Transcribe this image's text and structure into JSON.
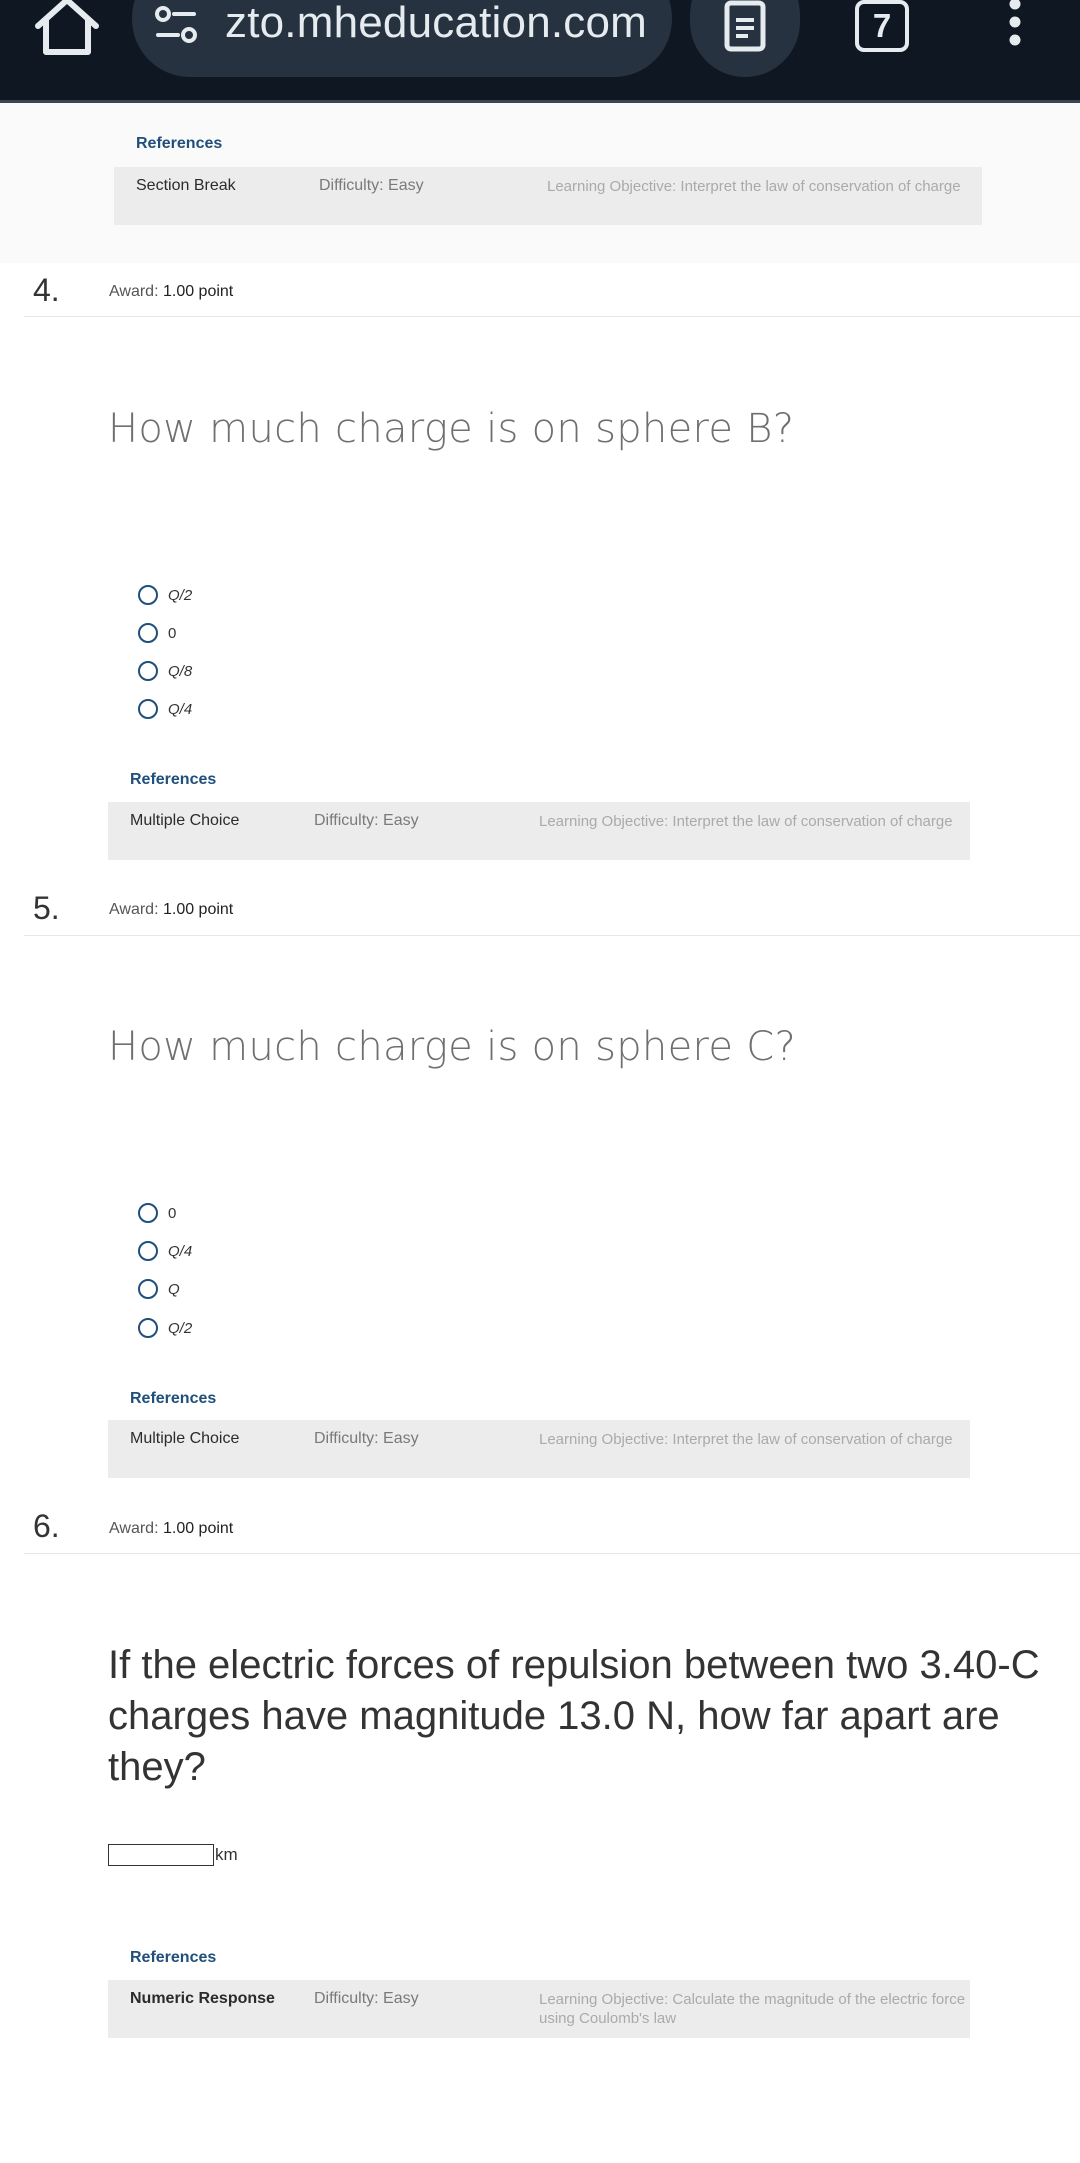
{
  "browser": {
    "url": "zto.mheducation.com",
    "tab_count": "7",
    "icons": [
      "home-icon",
      "site-settings-icon",
      "reader-mode-icon",
      "tabs-icon",
      "more-vert-icon"
    ]
  },
  "previous_block": {
    "references_label": "References",
    "type": "Section Break",
    "difficulty": "Difficulty: Easy",
    "objective": "Learning Objective: Interpret the law of conservation of charge"
  },
  "questions": [
    {
      "number": "4.",
      "award_label": "Award:",
      "award_value": "1.00 point",
      "prompt": "How much charge is on sphere B?",
      "options": [
        "Q/2",
        "0",
        "Q/8",
        "Q/4"
      ],
      "references_label": "References",
      "type": "Multiple Choice",
      "difficulty": "Difficulty: Easy",
      "objective": "Learning Objective: Interpret the law of conservation of charge"
    },
    {
      "number": "5.",
      "award_label": "Award:",
      "award_value": "1.00 point",
      "prompt": "How much charge is on sphere C?",
      "options": [
        "0",
        "Q/4",
        "Q",
        "Q/2"
      ],
      "references_label": "References",
      "type": "Multiple Choice",
      "difficulty": "Difficulty: Easy",
      "objective": "Learning Objective: Interpret the law of conservation of charge"
    },
    {
      "number": "6.",
      "award_label": "Award:",
      "award_value": "1.00 point",
      "prompt": "If the electric forces of repulsion between two 3.40-C charges have magnitude 13.0 N, how far apart are they?",
      "answer_value": "",
      "unit": "km",
      "references_label": "References",
      "type": "Numeric Response",
      "difficulty": "Difficulty: Easy",
      "objective": "Learning Objective: Calculate the magnitude of the electric force using Coulomb's law"
    }
  ],
  "colors": {
    "topbar": "#0f1722",
    "urlbar": "#26323f",
    "link": "#1f4f7a",
    "meta_bg": "#ececec"
  }
}
